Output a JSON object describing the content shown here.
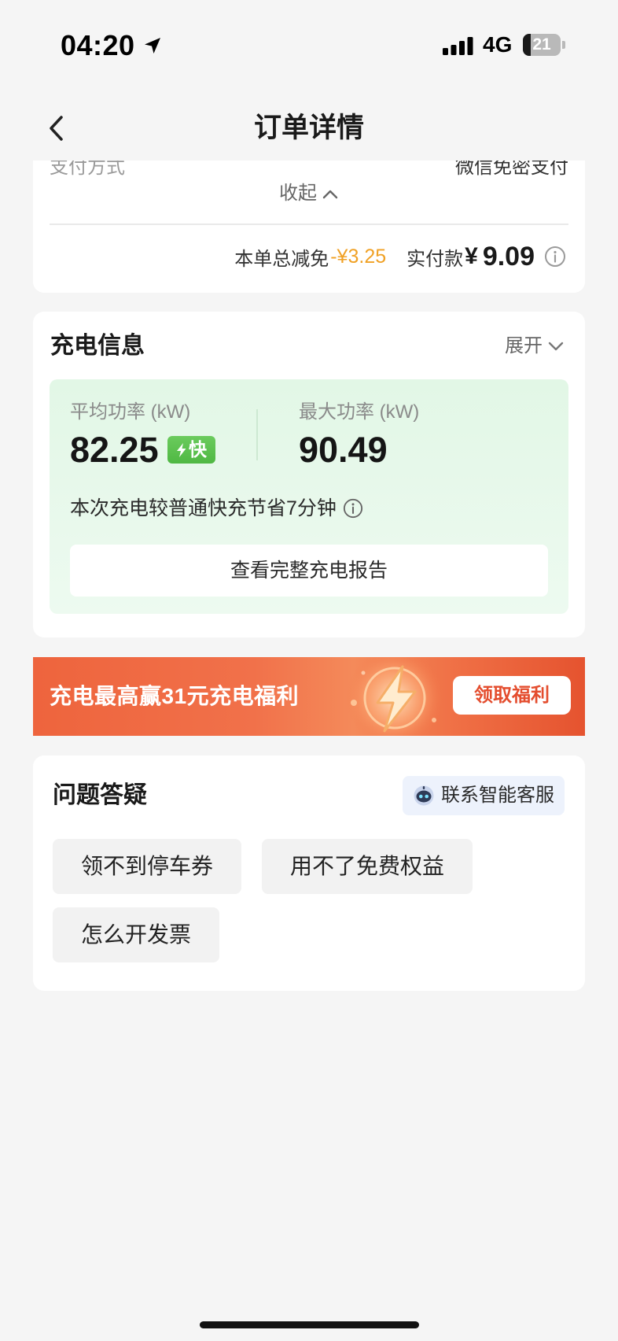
{
  "status_bar": {
    "time": "04:20",
    "network": "4G",
    "battery_level": "21",
    "location_icon": "location-arrow-icon",
    "signal_icon": "signal-bars-icon"
  },
  "nav": {
    "title": "订单详情",
    "back_icon": "chevron-left-icon"
  },
  "payment_card": {
    "pay_method_label": "支付方式",
    "pay_method_value": "微信免密支付",
    "collapse_label": "收起",
    "discount_label": "本单总减免",
    "discount_value": "-¥3.25",
    "paid_label": "实付款",
    "currency": "¥",
    "paid_amount": "9.09"
  },
  "charging_info": {
    "title": "充电信息",
    "expand_label": "展开",
    "avg_power_label": "平均功率 (kW)",
    "avg_power_value": "82.25",
    "fast_badge": "快",
    "max_power_label": "最大功率 (kW)",
    "max_power_value": "90.49",
    "saving_note": "本次充电较普通快充节省7分钟",
    "report_button": "查看完整充电报告"
  },
  "promo_banner": {
    "text": "充电最高赢31元充电福利",
    "button": "领取福利"
  },
  "faq": {
    "title": "问题答疑",
    "support_button": "联系智能客服",
    "questions": [
      "领不到停车券",
      "用不了免费权益",
      "怎么开发票"
    ]
  },
  "colors": {
    "accent_orange": "#f0a125",
    "fast_green": "#4fb843",
    "banner_orange": "#ef6a41",
    "claim_red": "#e44d2e",
    "page_bg": "#f5f5f5",
    "support_bg": "#edf2fc"
  }
}
